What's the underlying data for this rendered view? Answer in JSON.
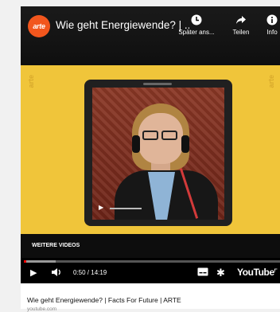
{
  "colors": {
    "accent": "#f2561d",
    "video_bg": "#f0c53a",
    "progress": "#ff0000"
  },
  "player": {
    "channel_logo_text": "arte",
    "title": "Wie geht Energiewende? | ...",
    "actions": [
      {
        "icon": "clock-icon",
        "label": "Später ans..."
      },
      {
        "icon": "share-icon",
        "label": "Teilen"
      },
      {
        "icon": "info-icon",
        "label": "Info"
      }
    ],
    "watermark": "arte",
    "more_videos_label": "WEITERE VIDEOS",
    "progress_fraction": 0.06,
    "time_display": "0:50 / 14:19",
    "brand": "YouTube"
  },
  "caption": {
    "title": "Wie geht Energiewende? | Facts For Future | ARTE",
    "source": "youtube.com"
  }
}
